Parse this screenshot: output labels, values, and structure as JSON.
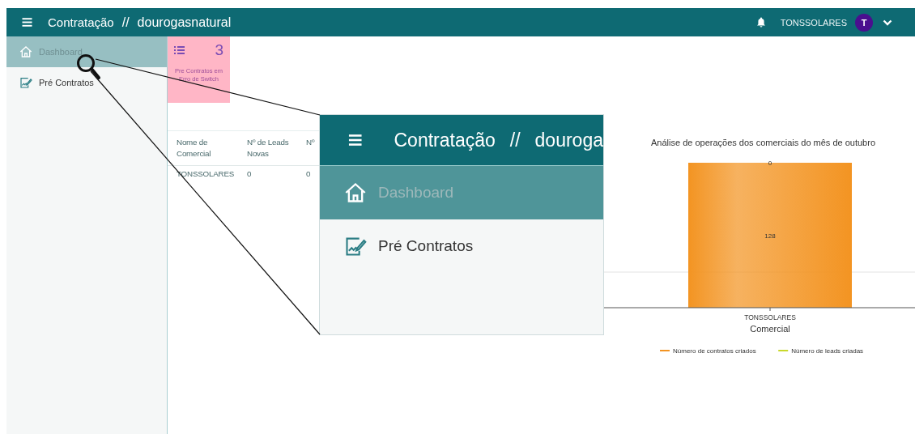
{
  "topbar": {
    "title": "Contratação",
    "separator": "//",
    "organization": "dourogasnatural",
    "user": "TONSSOLARES",
    "avatar_initial": "T"
  },
  "sidebar": {
    "items": [
      {
        "label": "Dashboard",
        "selected": true
      },
      {
        "label": "Pré Contratos",
        "selected": false
      }
    ]
  },
  "stat_card": {
    "count": "3",
    "label": "Pre Contratos em Erro de Switch"
  },
  "table": {
    "columns": [
      "Nome de Comercial",
      "Nº de Leads Novas",
      "Nº"
    ],
    "rows": [
      [
        "TONSSOLARES",
        "0",
        "0"
      ]
    ]
  },
  "chart": {
    "title": "Análise de operações dos comerciais do mês de outubro",
    "bar_labels": [
      "0",
      "128"
    ],
    "category": "TONSSOLARES",
    "axis_title": "Comercial",
    "legend": [
      {
        "name": "Número de contratos criados",
        "color": "#f39422"
      },
      {
        "name": "Número de leads criadas",
        "color": "#c9d82b"
      }
    ]
  },
  "zoom_inset": {
    "title": "Contratação",
    "separator": "//",
    "organization": "douroga",
    "items": [
      {
        "label": "Dashboard",
        "selected": true
      },
      {
        "label": "Pré Contratos",
        "selected": false
      }
    ]
  }
}
